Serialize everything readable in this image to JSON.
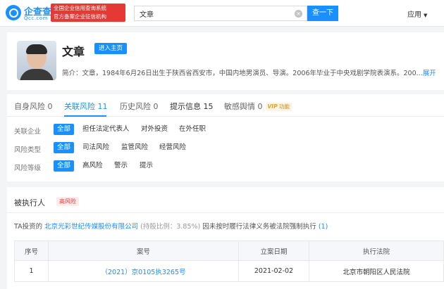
{
  "header": {
    "logo_text": "企查查",
    "logo_sub": "Qcc.com",
    "badge_line1": "全国企业信用查询系统",
    "badge_line2": "官方备案企业征信机构",
    "search_value": "文章",
    "search_button": "查一下",
    "apps_label": "应用"
  },
  "profile": {
    "name": "文章",
    "homepage_button": "进入主页",
    "intro": "简介：文章，1984年6月26日出生于陕西省西安市，中国内地男演员、导演。2006年毕业于中央戏剧学院表演系。200...",
    "expand": "展开"
  },
  "risk_tabs": [
    {
      "label": "自身风险 0"
    },
    {
      "label": "关联风险 11"
    },
    {
      "label": "历史风险 0"
    },
    {
      "label": "提示信息 15"
    },
    {
      "label": "敏感舆情 0"
    }
  ],
  "vip": {
    "prefix": "VIP",
    "label": "功能"
  },
  "filters": [
    {
      "label": "关联企业",
      "options": [
        "全部",
        "担任法定代表人",
        "对外投资",
        "在外任职"
      ]
    },
    {
      "label": "风险类型",
      "options": [
        "全部",
        "司法风险",
        "监管风险",
        "经营风险"
      ]
    },
    {
      "label": "风险等级",
      "options": [
        "全部",
        "高风险",
        "警示",
        "提示"
      ]
    }
  ],
  "executed": {
    "title": "被执行人",
    "risk_badge": "高风险",
    "desc_prefix": "TA投资的",
    "company": "北京光彩世纪传媒股份有限公司",
    "ratio": "(持股比例：3.85%)",
    "desc_suffix": "因未按时履行法律义务被法院强制执行",
    "count": "(1)",
    "columns": [
      "序号",
      "案号",
      "立案日期",
      "执行法院"
    ],
    "rows": [
      {
        "index": "1",
        "case_no": "（2021）京0105执3265号",
        "date": "2021-02-02",
        "court": "北京市朝阳区人民法院"
      }
    ]
  },
  "colors": {
    "accent": "#1890ff",
    "danger": "#e53935"
  },
  "icons": [
    "search-logo-icon",
    "clear-icon",
    "caret-down-icon"
  ]
}
